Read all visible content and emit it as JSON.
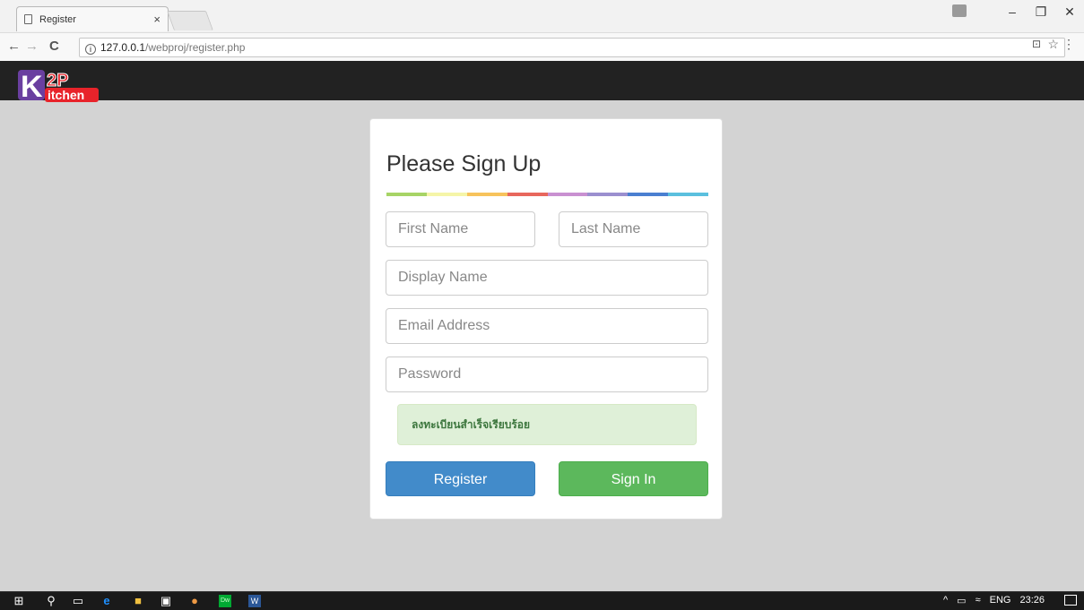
{
  "browser": {
    "tab_title": "Register",
    "tab_close": "×",
    "url_host": "127.0.0.1",
    "url_path": "/webproj/register.php",
    "info_glyph": "i",
    "icons": [
      "page-icon",
      "close-icon",
      "back-icon",
      "forward-icon",
      "reload-icon",
      "info-icon",
      "translate-icon",
      "star-icon",
      "menu-icon",
      "user-icon",
      "minimize-icon",
      "restore-icon",
      "close-window-icon"
    ]
  },
  "site": {
    "logo_top": "2P",
    "logo_letter": "K",
    "logo_text": "itchen"
  },
  "form": {
    "title": "Please Sign Up",
    "first_name_placeholder": "First Name",
    "last_name_placeholder": "Last Name",
    "display_name_placeholder": "Display Name",
    "email_placeholder": "Email Address",
    "password_placeholder": "Password",
    "success_message": "ลงทะเบียนสำเร็จเรียบร้อย",
    "register_label": "Register",
    "signin_label": "Sign In",
    "rainbow_colors": [
      "#a7d466",
      "#f5f5a8",
      "#f7c35c",
      "#e8675d",
      "#c990d1",
      "#9b8fcf",
      "#4a7fd1",
      "#5bc0de"
    ]
  },
  "taskbar": {
    "lang": "ENG",
    "time": "23:26",
    "apps": [
      "windows-icon",
      "search-icon",
      "task-view-icon",
      "edge-icon",
      "explorer-icon",
      "store-icon",
      "chrome-icon",
      "dreamweaver-icon",
      "word-icon"
    ]
  },
  "colors": {
    "navbar": "#222222",
    "register_button": "#428bca",
    "signin_button": "#5cb85c",
    "alert_bg": "#dff0d8",
    "alert_text": "#3c763d"
  }
}
